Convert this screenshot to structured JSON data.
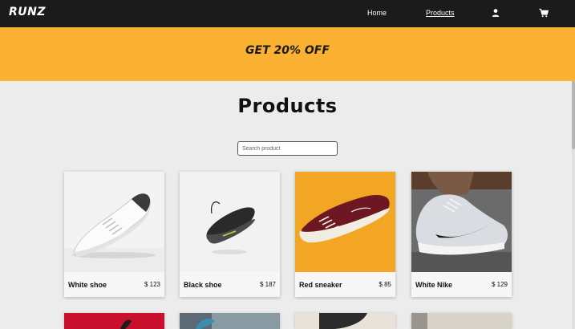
{
  "nav": {
    "logo": "RUNZ",
    "links": [
      {
        "label": "Home"
      },
      {
        "label": "Products",
        "active": true
      }
    ],
    "icons": [
      "user-icon",
      "cart-icon"
    ]
  },
  "promo": {
    "text": "GET 20% OFF",
    "color": "#fbb233"
  },
  "main": {
    "title": "Products",
    "search": {
      "placeholder": "Search product",
      "value": ""
    }
  },
  "products": [
    {
      "name": "White shoe",
      "price": "$ 123"
    },
    {
      "name": "Black shoe",
      "price": "$ 187"
    },
    {
      "name": "Red sneaker",
      "price": "$ 85"
    },
    {
      "name": "White Nike",
      "price": "$ 129"
    }
  ],
  "colors": {
    "navbar": "#1b1b1b",
    "background": "#ececec",
    "accent": "#fbb233"
  }
}
